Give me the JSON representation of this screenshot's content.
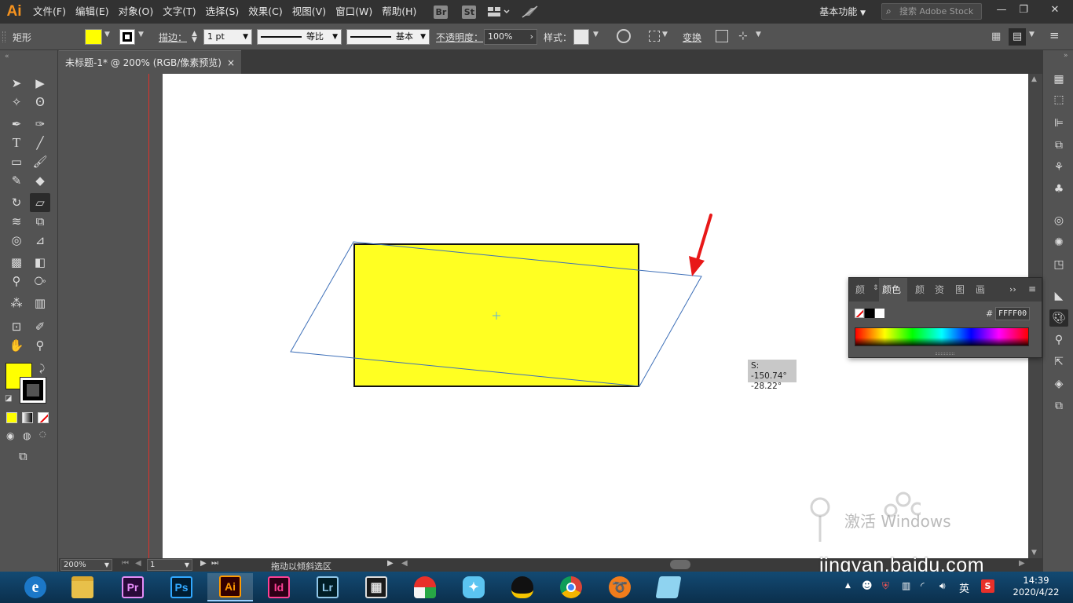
{
  "menubar": {
    "logo": "Ai",
    "items": [
      "文件(F)",
      "编辑(E)",
      "对象(O)",
      "文字(T)",
      "选择(S)",
      "效果(C)",
      "视图(V)",
      "窗口(W)",
      "帮助(H)"
    ],
    "bridge_label": "Br",
    "stock_label": "St",
    "workspace": "基本功能",
    "search_placeholder": "搜索 Adobe Stock"
  },
  "controlbar": {
    "selection_type": "矩形",
    "fill_color": "#ffff00",
    "stroke_label": "描边：",
    "stroke_weight": "1 pt",
    "profile_1": "等比",
    "profile_2": "基本",
    "opacity_label": "不透明度：",
    "opacity_value": "100%",
    "style_label": "样式：",
    "transform_label": "变换"
  },
  "document": {
    "tab_title": "未标题-1* @ 200% (RGB/像素预览)",
    "close_symbol": "×"
  },
  "canvas": {
    "rect_fill": "#ffff22",
    "shear_readout_line1": "S: -150.74°",
    "shear_readout_line2": "-28.22°"
  },
  "color_panel": {
    "tabs": [
      "颜",
      "颜色",
      "颜",
      "资",
      "图",
      "画"
    ],
    "hash": "#",
    "hex_value": "FFFF00"
  },
  "statusbar": {
    "zoom": "200%",
    "artboard_number": "1",
    "status_text": "拖动以倾斜选区"
  },
  "watermark": {
    "activate_text": "激活 Windows",
    "baidu_url": "jingyan.baidu.com"
  },
  "taskbar": {
    "apps": [
      {
        "name": "browser",
        "label": "e"
      },
      {
        "name": "file-explorer",
        "label": ""
      },
      {
        "name": "premiere",
        "label": "Pr"
      },
      {
        "name": "photoshop",
        "label": "Ps"
      },
      {
        "name": "illustrator",
        "label": "Ai"
      },
      {
        "name": "indesign",
        "label": "Id"
      },
      {
        "name": "lightroom",
        "label": "Lr"
      },
      {
        "name": "video-editor",
        "label": ""
      },
      {
        "name": "umbrella-app",
        "label": ""
      },
      {
        "name": "bird-app",
        "label": ""
      },
      {
        "name": "qq",
        "label": ""
      },
      {
        "name": "chrome",
        "label": ""
      },
      {
        "name": "orange-app",
        "label": ""
      },
      {
        "name": "notebook-app",
        "label": ""
      }
    ],
    "ime": "英",
    "time": "14:39",
    "date": "2020/4/22"
  }
}
